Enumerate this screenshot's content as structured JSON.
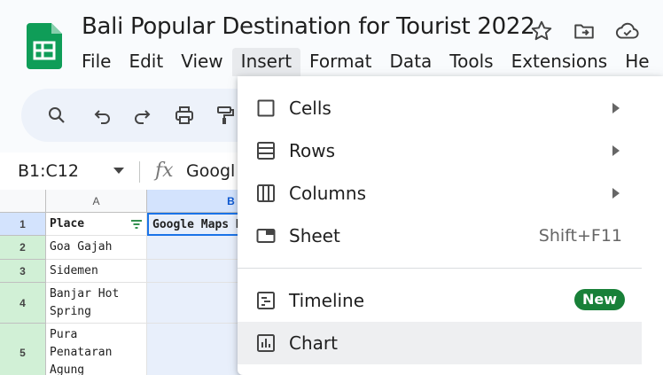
{
  "app": {
    "title": "Bali Popular Destination for Tourist 2022"
  },
  "menubar": [
    "File",
    "Edit",
    "View",
    "Insert",
    "Format",
    "Data",
    "Tools",
    "Extensions",
    "He"
  ],
  "formula_bar": {
    "name_box": "B1:C12",
    "fx": "fx",
    "content": "Googl"
  },
  "columns": [
    "A",
    "B"
  ],
  "rows": [
    {
      "num": "1",
      "a": "Place",
      "b": "Google Maps R"
    },
    {
      "num": "2",
      "a": "Goa Gajah",
      "b": ""
    },
    {
      "num": "3",
      "a": "Sidemen Valley",
      "b": ""
    },
    {
      "num": "4",
      "a": "Banjar Hot Spring",
      "b": ""
    },
    {
      "num": "5",
      "a": "Pura Penataran Agung Lempuyang",
      "b": ""
    }
  ],
  "insert_menu": {
    "items": [
      {
        "label": "Cells",
        "icon": "square-outline-icon",
        "submenu": true
      },
      {
        "label": "Rows",
        "icon": "rows-icon",
        "submenu": true
      },
      {
        "label": "Columns",
        "icon": "columns-icon",
        "submenu": true
      },
      {
        "label": "Sheet",
        "icon": "sheet-tab-icon",
        "shortcut": "Shift+F11"
      },
      {
        "label": "Timeline",
        "icon": "timeline-icon",
        "badge": "New"
      },
      {
        "label": "Chart",
        "icon": "chart-icon",
        "highlighted": true
      }
    ]
  },
  "colors": {
    "accent": "#1a73e8",
    "badge": "#188038",
    "selection": "#d3e3fd",
    "logo": "#0f9d58"
  }
}
